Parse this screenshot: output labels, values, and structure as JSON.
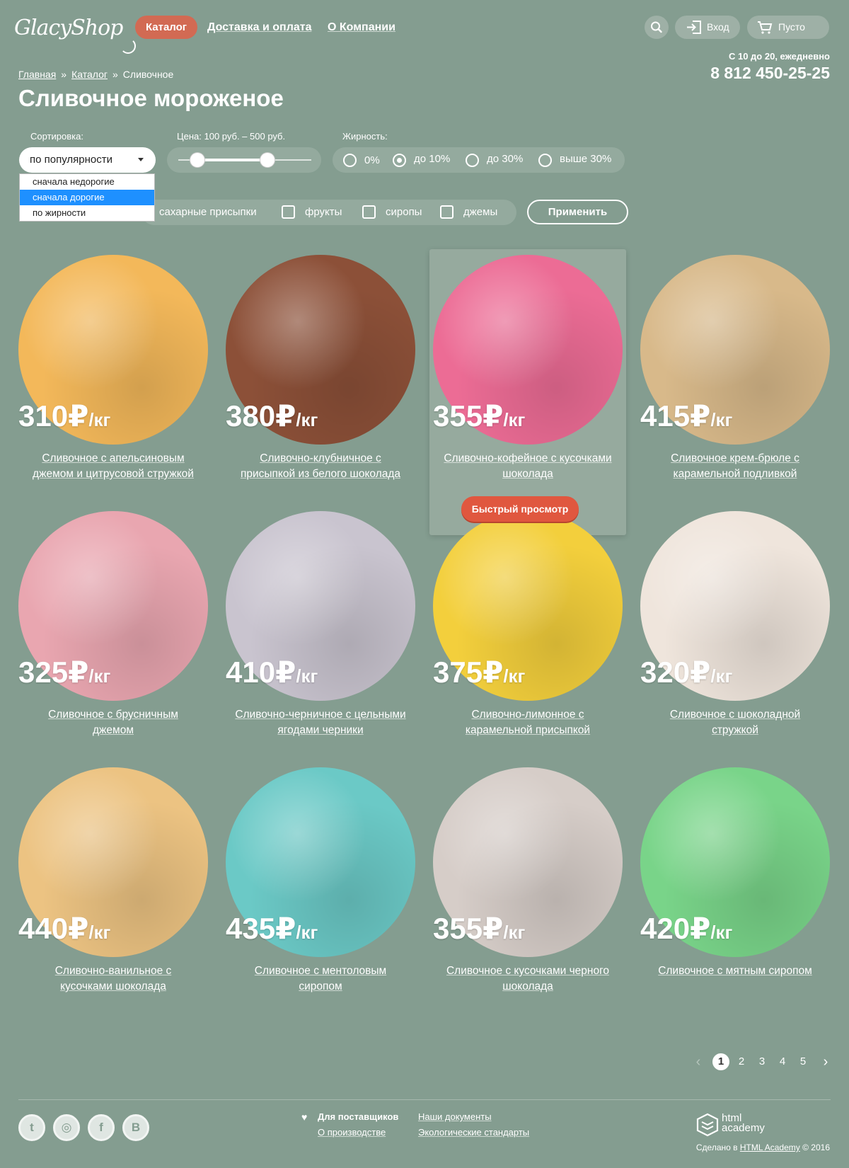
{
  "header": {
    "logo": "GlacyShop",
    "nav": [
      {
        "label": "Каталог",
        "active": true
      },
      {
        "label": "Доставка и оплата"
      },
      {
        "label": "О Компании"
      }
    ],
    "login": "Вход",
    "cart": "Пусто",
    "hours": "С 10 до 20, ежедневно",
    "phone": "8 812 450-25-25"
  },
  "breadcrumbs": [
    "Главная",
    "Каталог",
    "Сливочное"
  ],
  "breadcrumb_separator": "»",
  "page_title": "Сливочное мороженое",
  "filters": {
    "sort_label": "Сортировка:",
    "sort_value": "по популярности",
    "sort_options": [
      "сначала недорогие",
      "сначала дорогие",
      "по жирности"
    ],
    "sort_highlighted": "сначала дорогие",
    "price_label": "Цена: 100 руб. – 500 руб.",
    "price_min": 100,
    "price_max": 500,
    "fat_label": "Жирность:",
    "fat_options": [
      "0%",
      "до 10%",
      "до 30%",
      "выше 30%"
    ],
    "fat_selected": "до 10%",
    "extras": [
      "сахарные присыпки",
      "фрукты",
      "сиропы",
      "джемы"
    ],
    "apply": "Применить"
  },
  "products": [
    {
      "price": "310",
      "name_l1": "Сливочное с апельсиновым",
      "name_l2": "джемом и цитрусовой стружкой",
      "color": "#f3b85a"
    },
    {
      "price": "380",
      "name_l1": "Сливочно-клубничное с",
      "name_l2": "присыпкой из белого шоколада",
      "color": "#8c5038"
    },
    {
      "price": "355",
      "name_l1": "Сливочно-кофейное с кусочками",
      "name_l2": "шоколада",
      "color": "#ec6c95"
    },
    {
      "price": "415",
      "name_l1": "Сливочное крем-брюле с",
      "name_l2": "карамельной подливкой",
      "color": "#d8b98a"
    },
    {
      "price": "325",
      "name_l1": "Сливочное с брусничным",
      "name_l2": "джемом",
      "color": "#e9a6b0"
    },
    {
      "price": "410",
      "name_l1": "Сливочно-черничное с цельными",
      "name_l2": "ягодами черники",
      "color": "#c9c4cf"
    },
    {
      "price": "375",
      "name_l1": "Сливочно-лимонное с",
      "name_l2": "карамельной присыпкой",
      "color": "#f3cf3c"
    },
    {
      "price": "320",
      "name_l1": "Сливочное с шоколадной",
      "name_l2": "стружкой",
      "color": "#efe5dc"
    },
    {
      "price": "440",
      "name_l1": "Сливочно-ванильное с",
      "name_l2": "кусочками шоколада",
      "color": "#ecc382"
    },
    {
      "price": "435",
      "name_l1": "Сливочное с ментоловым",
      "name_l2": "сиропом",
      "color": "#6bc9c6"
    },
    {
      "price": "355",
      "name_l1": "Сливочное с кусочками черного",
      "name_l2": "шоколада",
      "color": "#d6cdc8"
    },
    {
      "price": "420",
      "name_l1": "Сливочное с мятным сиропом",
      "name_l2": "",
      "color": "#79d489"
    }
  ],
  "currency": "₽",
  "unit": "/кг",
  "quick_view": "Быстрый просмотр",
  "pagination": {
    "pages": [
      "1",
      "2",
      "3",
      "4",
      "5"
    ],
    "current": "1"
  },
  "footer": {
    "social": [
      "twitter",
      "instagram",
      "facebook",
      "vkontakte"
    ],
    "suppliers": "Для поставщиков",
    "production": "О производстве",
    "documents": "Наши документы",
    "eco": "Экологические стандарты",
    "academy_l1": "html",
    "academy_l2": "academy",
    "made_prefix": "Сделано в",
    "made_link": "HTML Academy",
    "made_year": "© 2016"
  }
}
